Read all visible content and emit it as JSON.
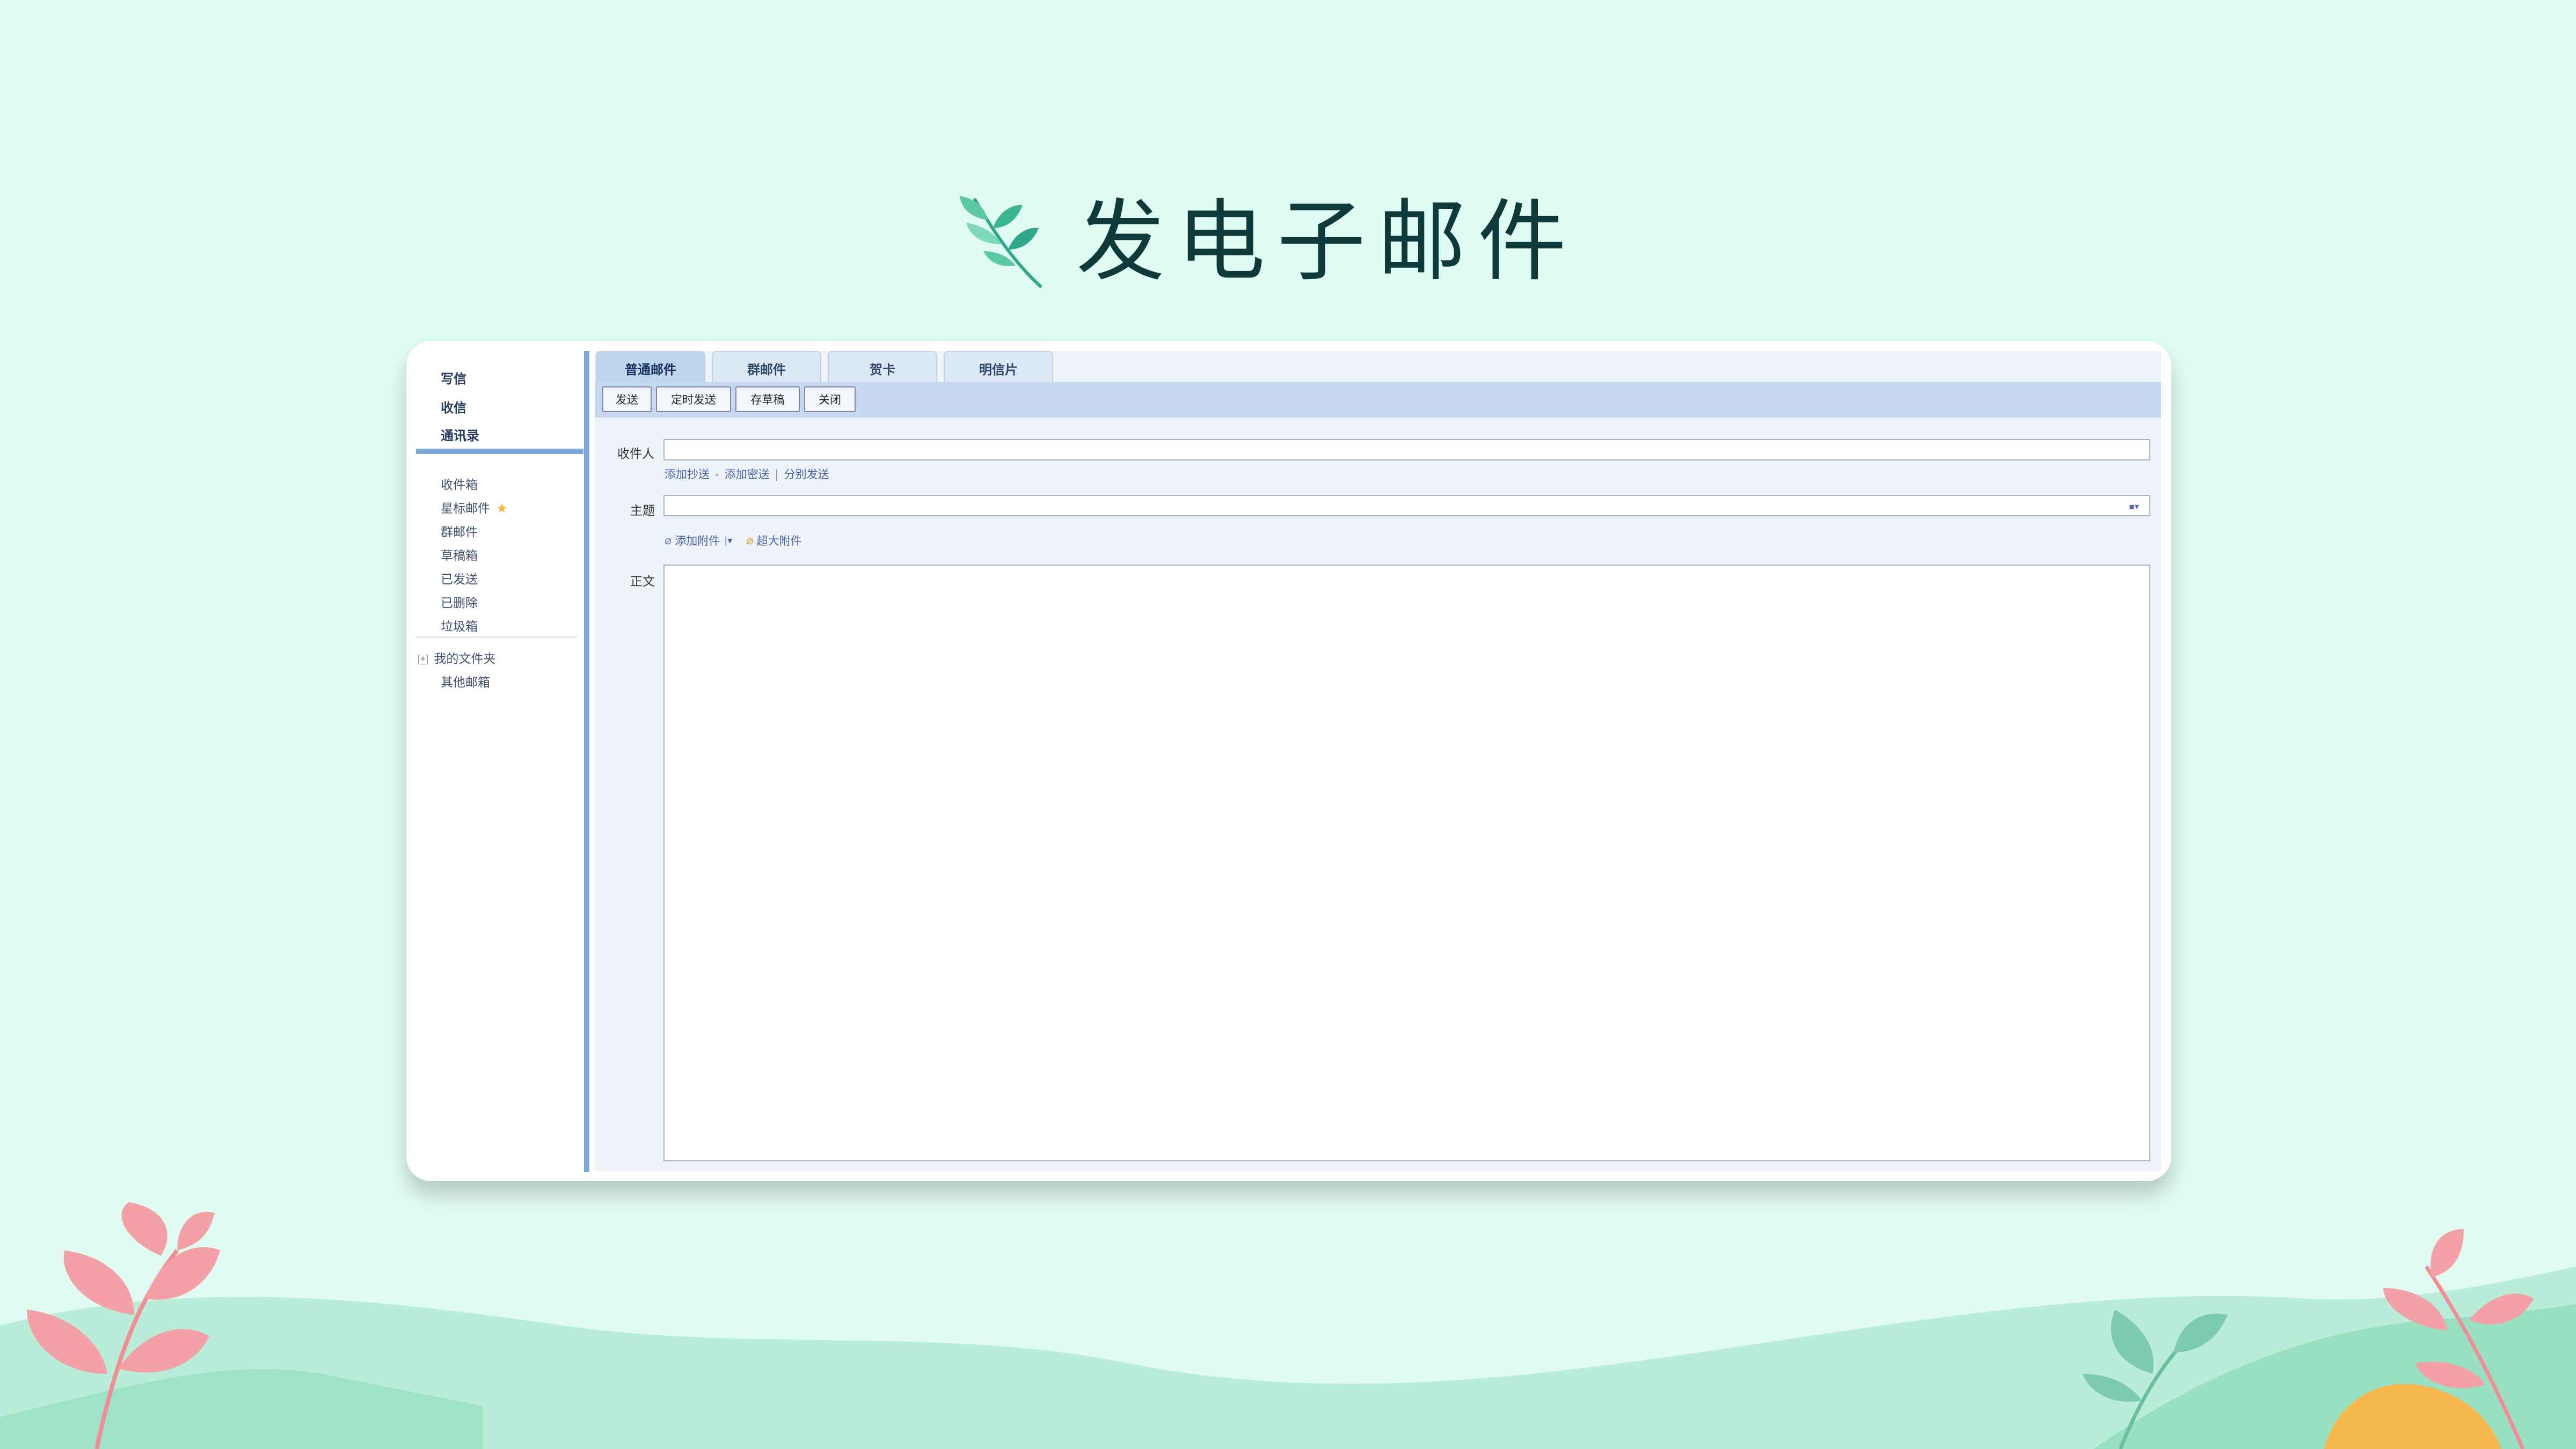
{
  "slide": {
    "title": "发电子邮件"
  },
  "colors": {
    "background": "#e0fbf2",
    "title": "#0f3a3c",
    "toolbar": "#c5d8f0",
    "panel": "#eef3fa",
    "sidebar_bar": "#7da6d9",
    "link": "#4a63a3"
  },
  "sidebar": {
    "top_items": [
      {
        "label": "写信"
      },
      {
        "label": "收信"
      },
      {
        "label": "通讯录"
      }
    ],
    "folders": [
      {
        "label": "收件箱"
      },
      {
        "label": "星标邮件",
        "icon": "star-icon"
      },
      {
        "label": "群邮件"
      },
      {
        "label": "草稿箱"
      },
      {
        "label": "已发送"
      },
      {
        "label": "已删除"
      },
      {
        "label": "垃圾箱"
      }
    ],
    "my_folders": {
      "label": "我的文件夹",
      "icon": "expand-plus-icon"
    },
    "other_mailboxes": {
      "label": "其他邮箱"
    }
  },
  "tabs": [
    {
      "label": "普通邮件",
      "active": true
    },
    {
      "label": "群邮件",
      "active": false
    },
    {
      "label": "贺卡",
      "active": false
    },
    {
      "label": "明信片",
      "active": false
    }
  ],
  "toolbar": {
    "send": "发送",
    "scheduled_send": "定时发送",
    "save_draft": "存草稿",
    "close": "关闭"
  },
  "compose": {
    "recipient_label": "收件人",
    "recipient_value": "",
    "add_cc": "添加抄送",
    "add_bcc": "添加密送",
    "separate_send": "分别发送",
    "subject_label": "主题",
    "subject_value": "",
    "add_attachment": "添加附件",
    "large_attachment": "超大附件",
    "body_label": "正文",
    "body_value": ""
  }
}
